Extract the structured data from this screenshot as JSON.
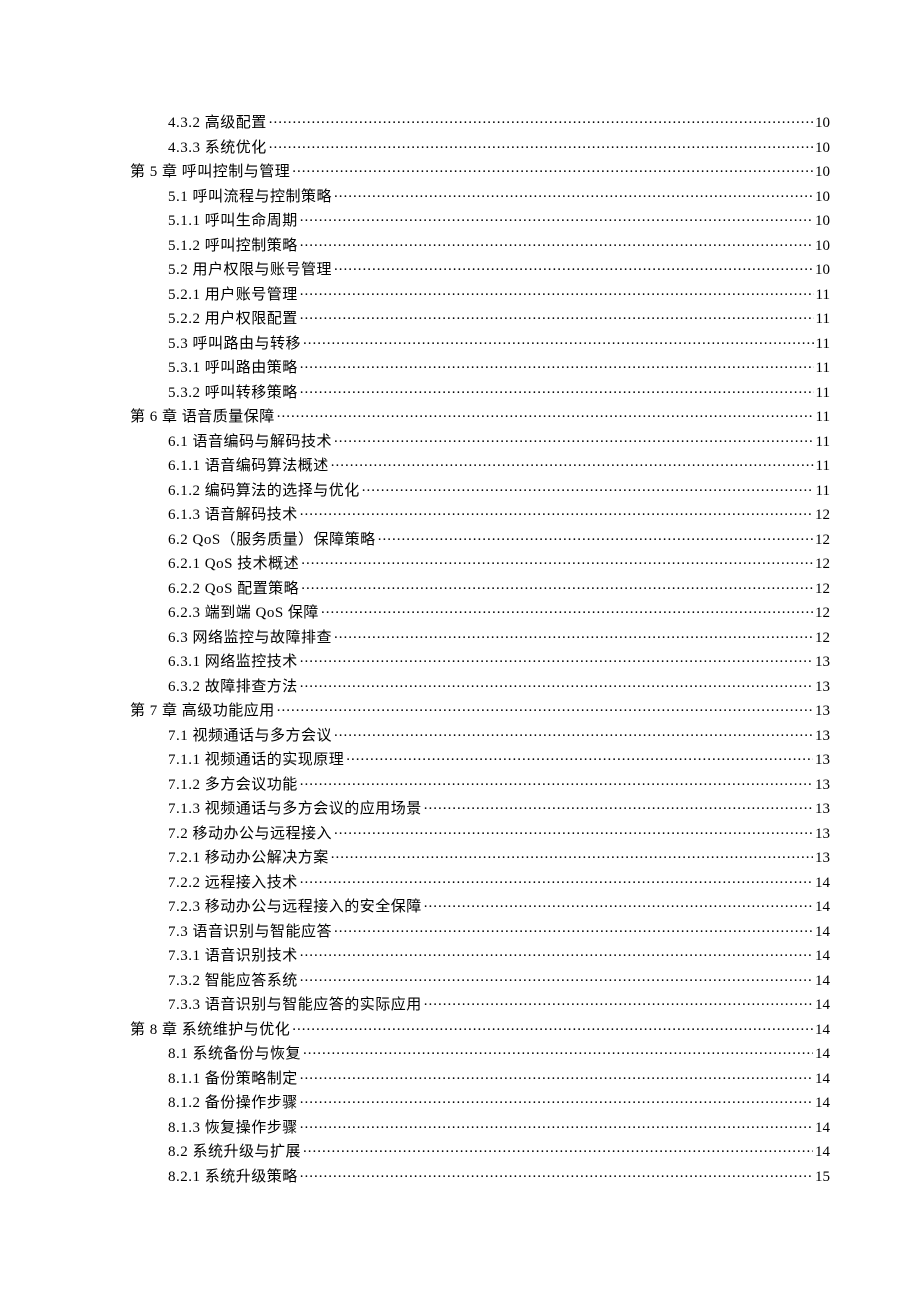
{
  "toc": [
    {
      "level": 2,
      "title": "4.3.2 高级配置",
      "page": "10"
    },
    {
      "level": 2,
      "title": "4.3.3 系统优化",
      "page": "10"
    },
    {
      "level": 1,
      "title": "第 5 章 呼叫控制与管理",
      "page": "10"
    },
    {
      "level": 2,
      "title": "5.1 呼叫流程与控制策略",
      "page": "10"
    },
    {
      "level": 2,
      "title": "5.1.1 呼叫生命周期",
      "page": "10"
    },
    {
      "level": 2,
      "title": "5.1.2 呼叫控制策略",
      "page": "10"
    },
    {
      "level": 2,
      "title": "5.2 用户权限与账号管理",
      "page": "10"
    },
    {
      "level": 2,
      "title": "5.2.1 用户账号管理",
      "page": "11"
    },
    {
      "level": 2,
      "title": "5.2.2 用户权限配置",
      "page": "11"
    },
    {
      "level": 2,
      "title": "5.3 呼叫路由与转移",
      "page": "11"
    },
    {
      "level": 2,
      "title": "5.3.1 呼叫路由策略",
      "page": "11"
    },
    {
      "level": 2,
      "title": "5.3.2 呼叫转移策略",
      "page": "11"
    },
    {
      "level": 1,
      "title": "第 6 章 语音质量保障",
      "page": "11"
    },
    {
      "level": 2,
      "title": "6.1 语音编码与解码技术",
      "page": "11"
    },
    {
      "level": 2,
      "title": "6.1.1 语音编码算法概述",
      "page": "11"
    },
    {
      "level": 2,
      "title": "6.1.2 编码算法的选择与优化",
      "page": "11"
    },
    {
      "level": 2,
      "title": "6.1.3 语音解码技术",
      "page": "12"
    },
    {
      "level": 2,
      "title": "6.2 QoS（服务质量）保障策略",
      "page": "12"
    },
    {
      "level": 2,
      "title": "6.2.1 QoS 技术概述",
      "page": "12"
    },
    {
      "level": 2,
      "title": "6.2.2 QoS 配置策略",
      "page": "12"
    },
    {
      "level": 2,
      "title": "6.2.3 端到端 QoS 保障",
      "page": "12"
    },
    {
      "level": 2,
      "title": "6.3 网络监控与故障排查",
      "page": "12"
    },
    {
      "level": 2,
      "title": "6.3.1 网络监控技术",
      "page": "13"
    },
    {
      "level": 2,
      "title": "6.3.2 故障排查方法",
      "page": "13"
    },
    {
      "level": 1,
      "title": "第 7 章 高级功能应用",
      "page": "13"
    },
    {
      "level": 2,
      "title": "7.1 视频通话与多方会议",
      "page": "13"
    },
    {
      "level": 2,
      "title": "7.1.1 视频通话的实现原理",
      "page": "13"
    },
    {
      "level": 2,
      "title": "7.1.2 多方会议功能",
      "page": "13"
    },
    {
      "level": 2,
      "title": "7.1.3 视频通话与多方会议的应用场景",
      "page": "13"
    },
    {
      "level": 2,
      "title": "7.2 移动办公与远程接入",
      "page": "13"
    },
    {
      "level": 2,
      "title": "7.2.1 移动办公解决方案",
      "page": "13"
    },
    {
      "level": 2,
      "title": "7.2.2 远程接入技术",
      "page": "14"
    },
    {
      "level": 2,
      "title": "7.2.3 移动办公与远程接入的安全保障",
      "page": "14"
    },
    {
      "level": 2,
      "title": "7.3 语音识别与智能应答",
      "page": "14"
    },
    {
      "level": 2,
      "title": "7.3.1 语音识别技术",
      "page": "14"
    },
    {
      "level": 2,
      "title": "7.3.2 智能应答系统",
      "page": "14"
    },
    {
      "level": 2,
      "title": "7.3.3 语音识别与智能应答的实际应用",
      "page": "14"
    },
    {
      "level": 1,
      "title": "第 8 章 系统维护与优化",
      "page": "14"
    },
    {
      "level": 2,
      "title": "8.1 系统备份与恢复",
      "page": "14"
    },
    {
      "level": 2,
      "title": "8.1.1 备份策略制定",
      "page": "14"
    },
    {
      "level": 2,
      "title": "8.1.2 备份操作步骤",
      "page": "14"
    },
    {
      "level": 2,
      "title": "8.1.3 恢复操作步骤",
      "page": "14"
    },
    {
      "level": 2,
      "title": "8.2 系统升级与扩展",
      "page": "14"
    },
    {
      "level": 2,
      "title": "8.2.1 系统升级策略",
      "page": "15"
    }
  ]
}
